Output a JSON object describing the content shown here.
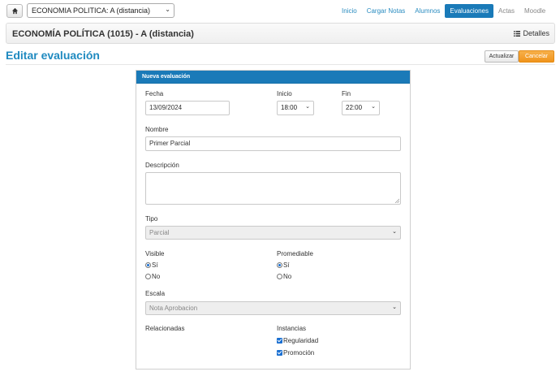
{
  "topbar": {
    "course_select_value": "ECONOMIA POLITICA: A (distancia)",
    "nav": [
      {
        "label": "Inicio",
        "active": false
      },
      {
        "label": "Cargar Notas",
        "active": false
      },
      {
        "label": "Alumnos",
        "active": false
      },
      {
        "label": "Evaluaciones",
        "active": true
      },
      {
        "label": "Actas",
        "active": false
      },
      {
        "label": "Moodle",
        "active": false
      }
    ]
  },
  "course_header": {
    "title": "ECONOMÍA POLÍTICA (1015) - A (distancia)",
    "details_label": "Detalles"
  },
  "page": {
    "title": "Editar evaluación",
    "update_label": "Actualizar",
    "cancel_label": "Cancelar"
  },
  "form": {
    "panel_title": "Nueva evaluación",
    "fecha_label": "Fecha",
    "fecha_value": "13/09/2024",
    "inicio_label": "Inicio",
    "inicio_value": "18:00",
    "fin_label": "Fin",
    "fin_value": "22:00",
    "nombre_label": "Nombre",
    "nombre_value": "Primer Parcial",
    "descripcion_label": "Descripción",
    "descripcion_value": "",
    "tipo_label": "Tipo",
    "tipo_value": "Parcial",
    "visible_label": "Visible",
    "visible_options": [
      {
        "label": "Sí",
        "checked": true
      },
      {
        "label": "No",
        "checked": false
      }
    ],
    "promediable_label": "Promediable",
    "promediable_options": [
      {
        "label": "Sí",
        "checked": true
      },
      {
        "label": "No",
        "checked": false
      }
    ],
    "escala_label": "Escala",
    "escala_value": "Nota Aprobacion",
    "relacionadas_label": "Relacionadas",
    "instancias_label": "Instancias",
    "instancias": [
      {
        "label": "Regularidad",
        "checked": true
      },
      {
        "label": "Promoción",
        "checked": true
      }
    ]
  }
}
